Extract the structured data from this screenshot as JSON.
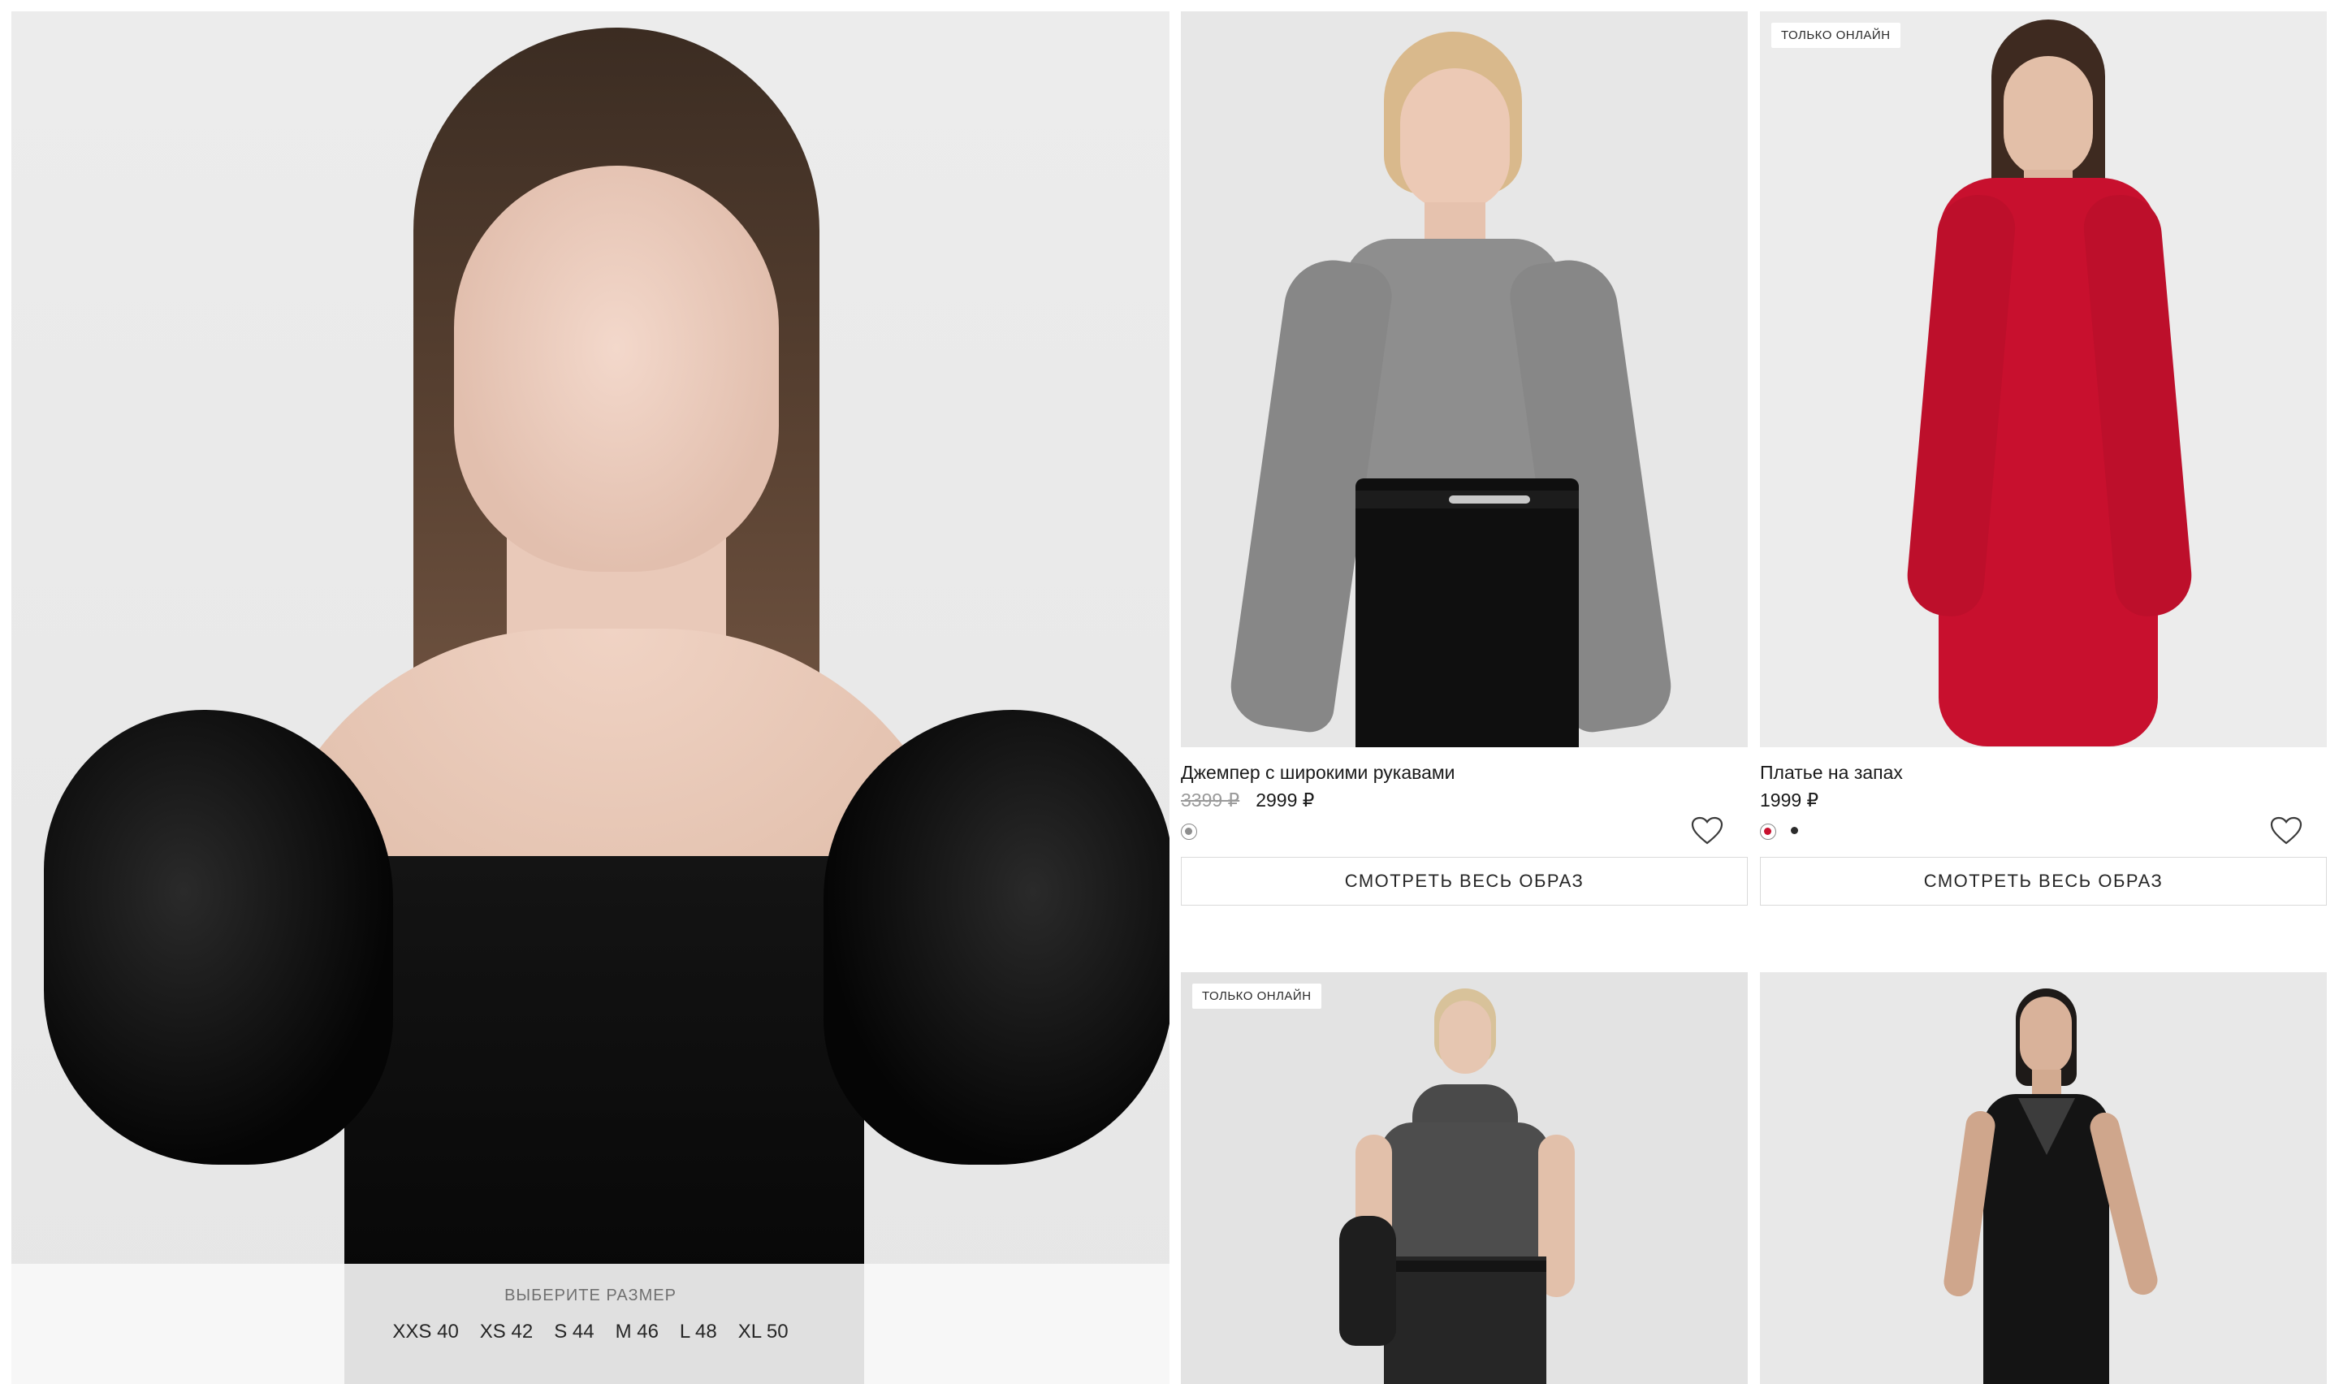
{
  "hero": {
    "size_title": "ВЫБЕРИТЕ РАЗМЕР",
    "sizes": [
      "XXS 40",
      "XS 42",
      "S 44",
      "M 46",
      "L 48",
      "XL 50"
    ]
  },
  "products": [
    {
      "name": "Джемпер с широкими рукавами",
      "old_price": "3399 ₽",
      "price": "2999 ₽",
      "colors": [
        "#8e8e8e"
      ],
      "look_button": "СМОТРЕТЬ ВЕСЬ ОБРАЗ"
    },
    {
      "badge": "ТОЛЬКО ОНЛАЙН",
      "name": "Платье на запах",
      "price": "1999 ₽",
      "colors": [
        "#c8102e",
        "#2b2b2b"
      ],
      "look_button": "СМОТРЕТЬ ВЕСЬ ОБРАЗ"
    },
    {
      "badge": "ТОЛЬКО ОНЛАЙН"
    },
    {}
  ],
  "icons": {
    "favorite": "heart-icon"
  }
}
